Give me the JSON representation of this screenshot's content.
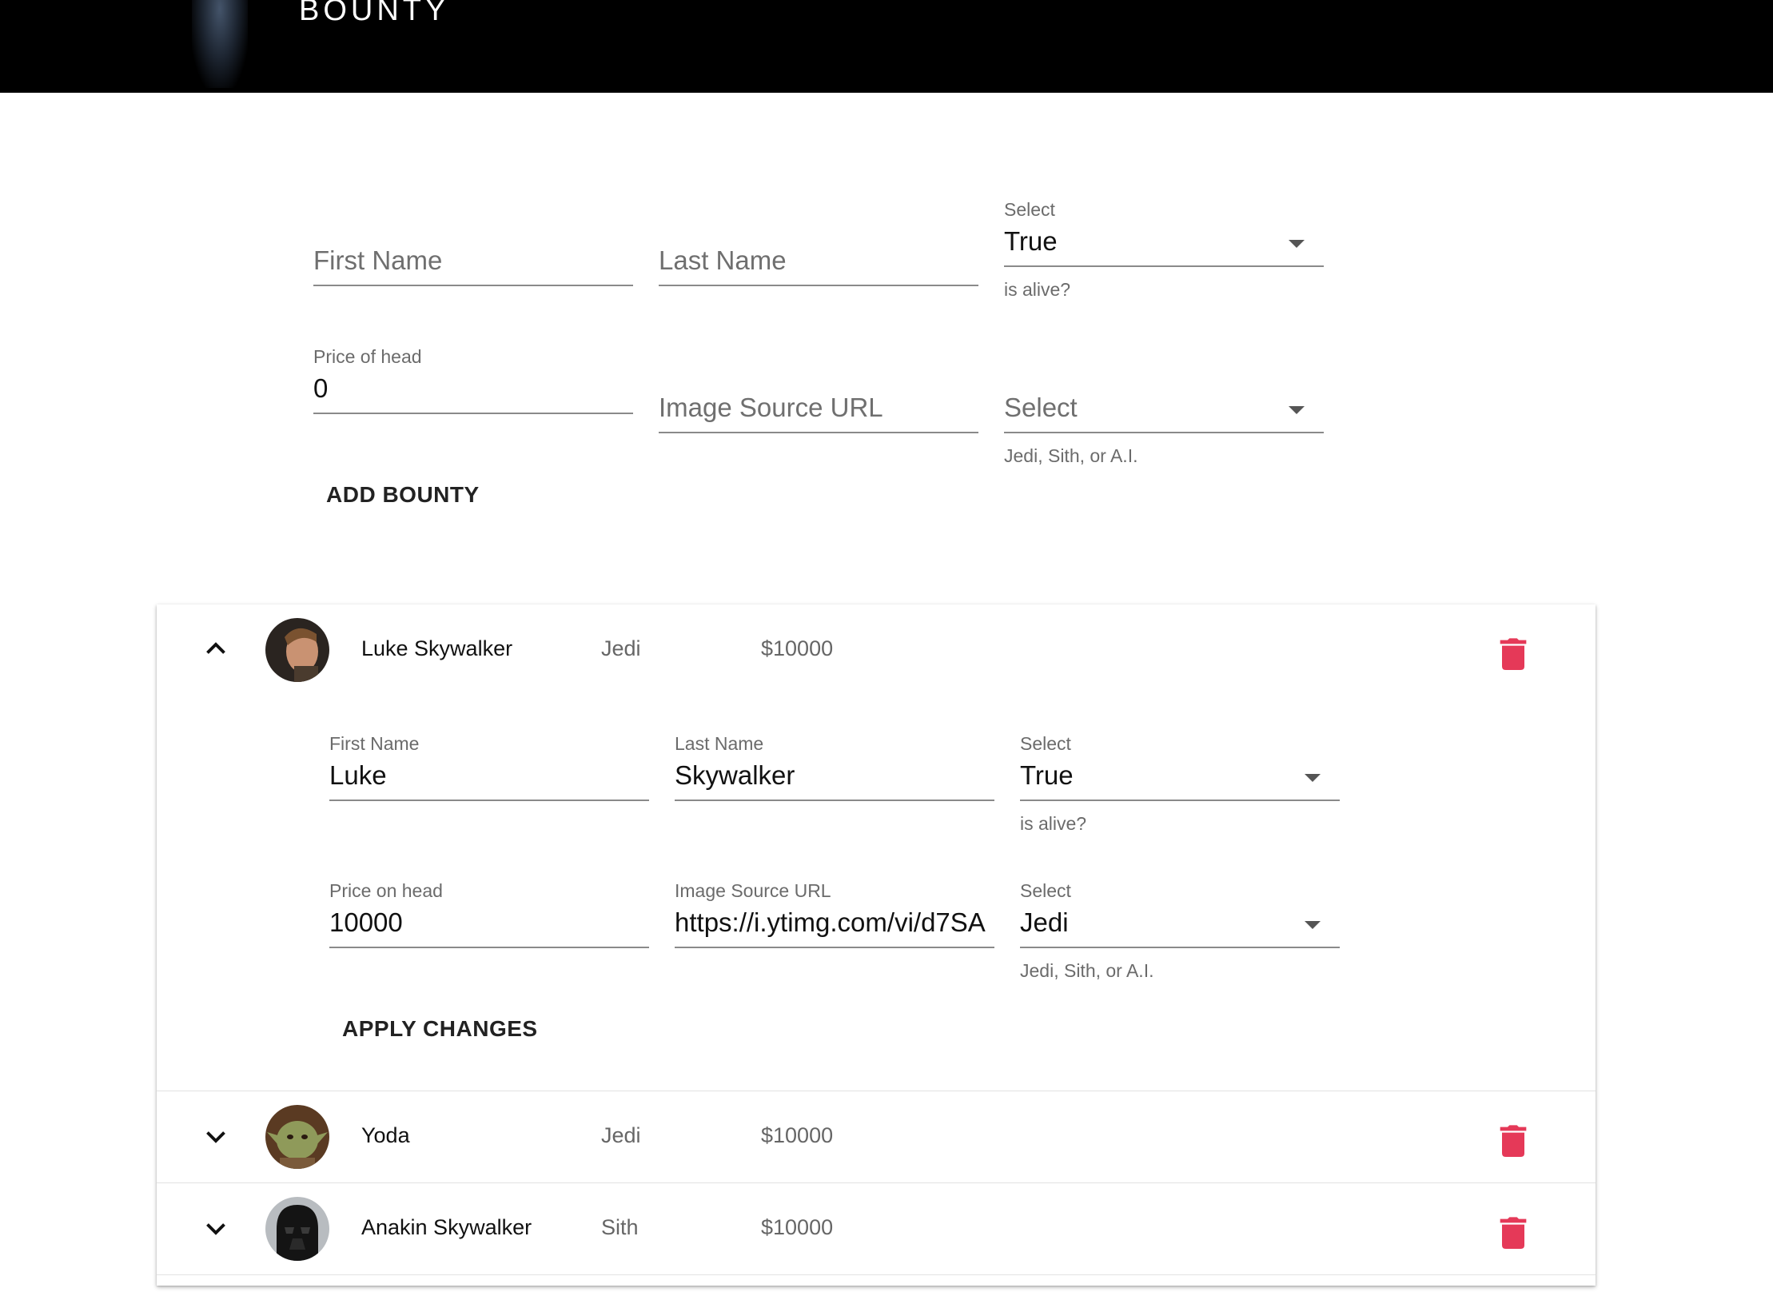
{
  "header": {
    "title": "BOUNTY"
  },
  "new_bounty_form": {
    "first_name_placeholder": "First Name",
    "last_name_placeholder": "Last Name",
    "alive_label": "Select",
    "alive_value": "True",
    "alive_helper": "is alive?",
    "price_label": "Price of head",
    "price_value": "0",
    "image_placeholder": "Image Source URL",
    "type_placeholder": "Select",
    "type_helper": "Jedi, Sith, or A.I.",
    "add_button": "ADD BOUNTY"
  },
  "bounties": [
    {
      "name": "Luke Skywalker",
      "type": "Jedi",
      "price": "$10000",
      "expanded": true
    },
    {
      "name": "Yoda",
      "type": "Jedi",
      "price": "$10000",
      "expanded": false
    },
    {
      "name": "Anakin Skywalker",
      "type": "Sith",
      "price": "$10000",
      "expanded": false
    }
  ],
  "edit_form": {
    "first_name_label": "First Name",
    "first_name_value": "Luke",
    "last_name_label": "Last Name",
    "last_name_value": "Skywalker",
    "alive_label": "Select",
    "alive_value": "True",
    "alive_helper": "is alive?",
    "price_label": "Price on head",
    "price_value": "10000",
    "image_label": "Image Source URL",
    "image_value": "https://i.ytimg.com/vi/d7SA",
    "type_label": "Select",
    "type_value": "Jedi",
    "type_helper": "Jedi, Sith, or A.I.",
    "apply_button": "APPLY CHANGES"
  },
  "colors": {
    "header_bg": "#000000",
    "delete_icon": "#e53958"
  },
  "icons": {
    "expand_less": "chevron-up-icon",
    "expand_more": "chevron-down-icon",
    "delete": "trash-icon"
  }
}
